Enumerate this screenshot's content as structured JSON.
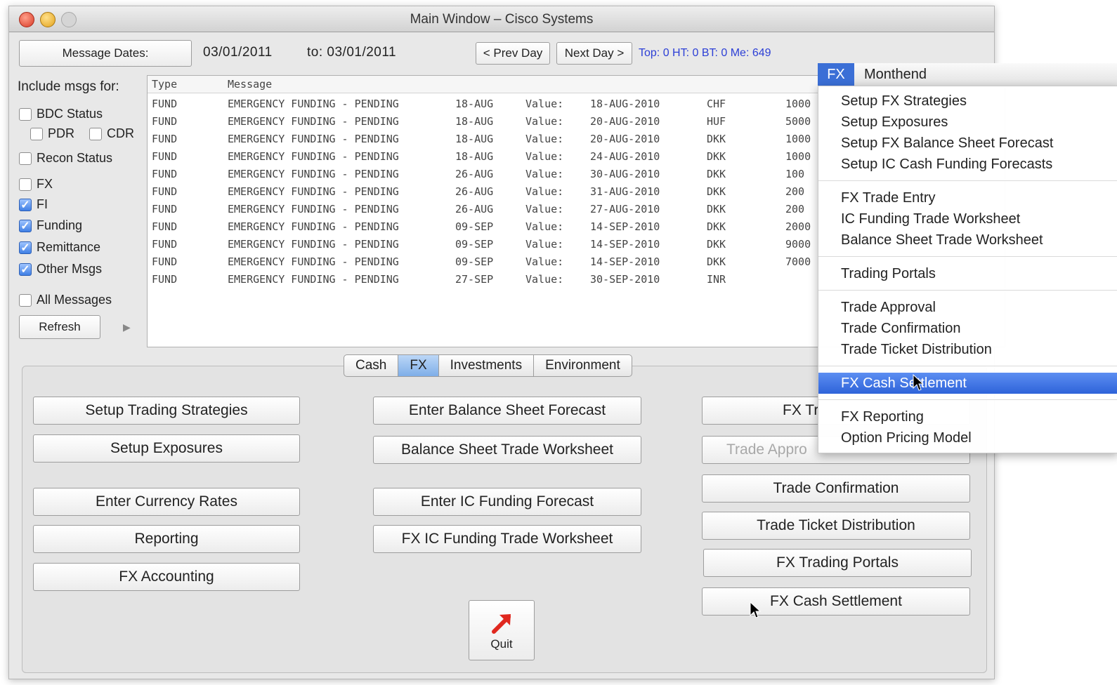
{
  "window": {
    "title": "Main Window – Cisco Systems"
  },
  "header": {
    "message_dates_label": "Message Dates:",
    "from_date": "03/01/2011",
    "to_label": "to: 03/01/2011",
    "prev_day": "< Prev Day",
    "next_day": "Next Day >",
    "status": "Top: 0  HT: 0 BT: 0 Me: 649"
  },
  "filters": {
    "title": "Include msgs for:",
    "items": [
      {
        "label": "BDC Status",
        "checked": false
      },
      {
        "label": "PDR",
        "checked": false
      },
      {
        "label": "CDR",
        "checked": false
      },
      {
        "label": "Recon Status",
        "checked": false
      },
      {
        "label": "FX",
        "checked": false
      },
      {
        "label": "FI",
        "checked": true
      },
      {
        "label": "Funding",
        "checked": true
      },
      {
        "label": "Remittance",
        "checked": true
      },
      {
        "label": "Other Msgs",
        "checked": true
      },
      {
        "label": "All Messages",
        "checked": false
      }
    ],
    "refresh": "Refresh",
    "arrow_glyph": "▶"
  },
  "messages": {
    "columns": [
      "Type",
      "Message"
    ],
    "rows": [
      {
        "type": "FUND",
        "message": "EMERGENCY FUNDING - PENDING",
        "date": "18-AUG",
        "value_label": "Value:",
        "value_date": "18-AUG-2010",
        "ccy": "CHF",
        "amount": "1000"
      },
      {
        "type": "FUND",
        "message": "EMERGENCY FUNDING - PENDING",
        "date": "18-AUG",
        "value_label": "Value:",
        "value_date": "20-AUG-2010",
        "ccy": "HUF",
        "amount": "5000"
      },
      {
        "type": "FUND",
        "message": "EMERGENCY FUNDING - PENDING",
        "date": "18-AUG",
        "value_label": "Value:",
        "value_date": "20-AUG-2010",
        "ccy": "DKK",
        "amount": "1000"
      },
      {
        "type": "FUND",
        "message": "EMERGENCY FUNDING - PENDING",
        "date": "18-AUG",
        "value_label": "Value:",
        "value_date": "24-AUG-2010",
        "ccy": "DKK",
        "amount": "1000"
      },
      {
        "type": "FUND",
        "message": "EMERGENCY FUNDING - PENDING",
        "date": "26-AUG",
        "value_label": "Value:",
        "value_date": "30-AUG-2010",
        "ccy": "DKK",
        "amount": "100"
      },
      {
        "type": "FUND",
        "message": "EMERGENCY FUNDING - PENDING",
        "date": "26-AUG",
        "value_label": "Value:",
        "value_date": "31-AUG-2010",
        "ccy": "DKK",
        "amount": "200"
      },
      {
        "type": "FUND",
        "message": "EMERGENCY FUNDING - PENDING",
        "date": "26-AUG",
        "value_label": "Value:",
        "value_date": "27-AUG-2010",
        "ccy": "DKK",
        "amount": "200"
      },
      {
        "type": "FUND",
        "message": "EMERGENCY FUNDING - PENDING",
        "date": "09-SEP",
        "value_label": "Value:",
        "value_date": "14-SEP-2010",
        "ccy": "DKK",
        "amount": "2000"
      },
      {
        "type": "FUND",
        "message": "EMERGENCY FUNDING - PENDING",
        "date": "09-SEP",
        "value_label": "Value:",
        "value_date": "14-SEP-2010",
        "ccy": "DKK",
        "amount": "9000"
      },
      {
        "type": "FUND",
        "message": "EMERGENCY FUNDING - PENDING",
        "date": "09-SEP",
        "value_label": "Value:",
        "value_date": "14-SEP-2010",
        "ccy": "DKK",
        "amount": "7000"
      },
      {
        "type": "FUND",
        "message": "EMERGENCY FUNDING - PENDING",
        "date": "27-SEP",
        "value_label": "Value:",
        "value_date": "30-SEP-2010",
        "ccy": "INR",
        "amount": ""
      }
    ]
  },
  "tabs": [
    {
      "label": "Cash",
      "active": false
    },
    {
      "label": "FX",
      "active": true
    },
    {
      "label": "Investments",
      "active": false
    },
    {
      "label": "Environment",
      "active": false
    }
  ],
  "fx_panel": {
    "col1": [
      "Setup Trading Strategies",
      "Setup Exposures",
      "Enter Currency Rates",
      "Reporting",
      "FX Accounting"
    ],
    "col2": [
      "Enter Balance Sheet Forecast",
      "Balance Sheet Trade Worksheet",
      "Enter IC Funding Forecast",
      "FX IC Funding Trade Worksheet"
    ],
    "col3": [
      "FX Tr",
      "Trade Appro",
      "Trade Confirmation",
      "Trade Ticket Distribution",
      "FX Trading Portals",
      "FX Cash Settlement"
    ],
    "quit": "Quit"
  },
  "menubar": {
    "active": "FX",
    "other": "Monthend"
  },
  "fx_menu": {
    "groups": [
      [
        "Setup FX Strategies",
        "Setup Exposures",
        "Setup FX Balance Sheet Forecast",
        "Setup IC Cash Funding Forecasts"
      ],
      [
        "FX Trade Entry",
        "IC Funding Trade Worksheet",
        "Balance Sheet Trade Worksheet"
      ],
      [
        "Trading Portals"
      ],
      [
        "Trade Approval",
        "Trade Confirmation",
        "Trade Ticket Distribution"
      ],
      [
        "FX Cash Settlement"
      ],
      [
        "FX Reporting",
        "Option Pricing Model"
      ]
    ],
    "highlighted": "FX Cash Settlement"
  },
  "colors": {
    "accent": "#2e63d9",
    "status_text": "#2c3fd6",
    "quit_arrow": "#e0281f"
  }
}
